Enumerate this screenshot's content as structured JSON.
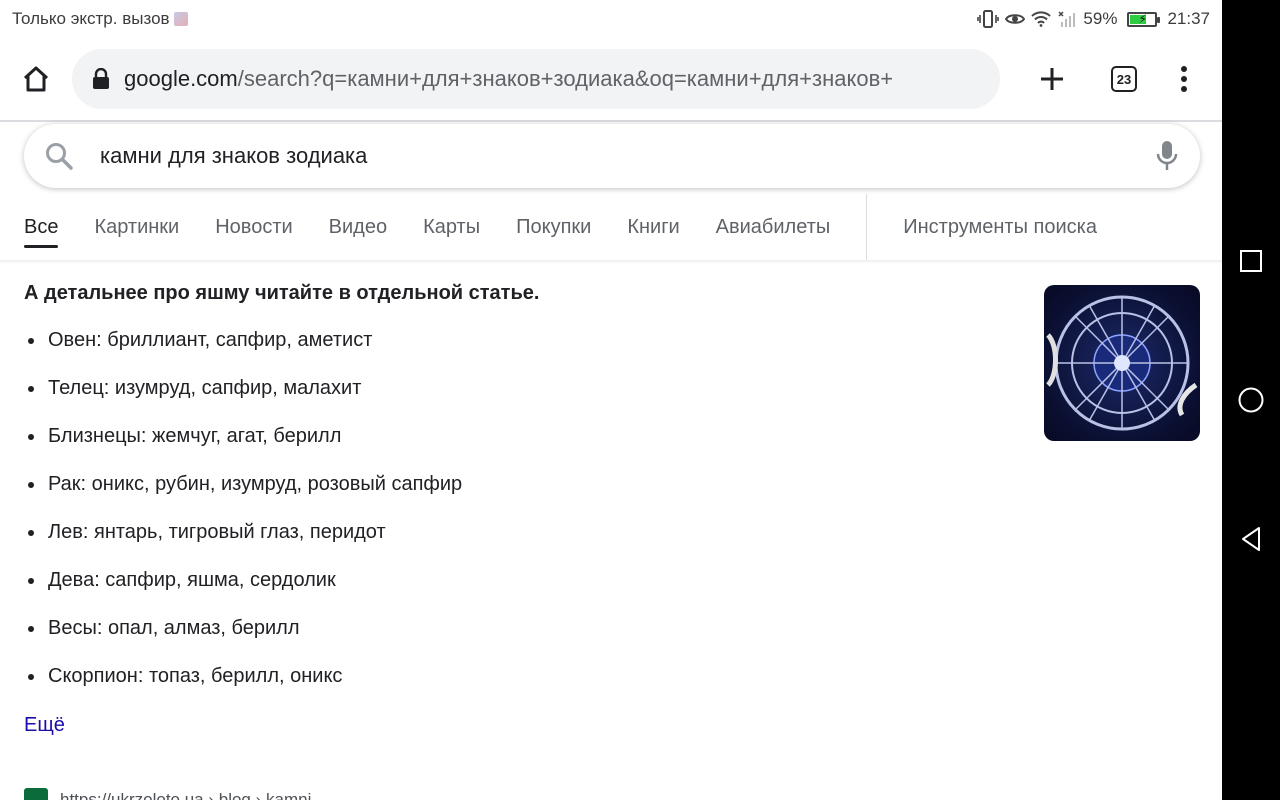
{
  "status_bar": {
    "carrier_text": "Только экстр. вызов",
    "battery_percent": "59%",
    "battery_level": 0.59,
    "time": "21:37"
  },
  "browser": {
    "url_domain": "google.com",
    "url_path": "/search?q=камни+для+знаков+зодиака&oq=камни+для+знаков+",
    "tabs_count": "23"
  },
  "search": {
    "query": "камни для знаков зодиака"
  },
  "tabs": [
    {
      "label": "Все",
      "active": true
    },
    {
      "label": "Картинки",
      "active": false
    },
    {
      "label": "Новости",
      "active": false
    },
    {
      "label": "Видео",
      "active": false
    },
    {
      "label": "Карты",
      "active": false
    },
    {
      "label": "Покупки",
      "active": false
    },
    {
      "label": "Книги",
      "active": false
    },
    {
      "label": "Авиабилеты",
      "active": false
    }
  ],
  "tools_label": "Инструменты поиска",
  "content": {
    "heading": "А детальнее про яшму читайте в отдельной статье.",
    "items": [
      "Овен: бриллиант, сапфир, аметист",
      "Телец: изумруд, сапфир, малахит",
      "Близнецы: жемчуг, агат, берилл",
      "Рак: оникс, рубин, изумруд, розовый сапфир",
      "Лев: янтарь, тигровый глаз, перидот",
      "Дева: сапфир, яшма, сердолик",
      "Весы: опал, алмаз, берилл",
      "Скорпион: топаз, берилл, оникс"
    ],
    "more_link": "Ещё",
    "next_result_url": "https://ukrzoloto.ua › blog › kamni"
  },
  "colors": {
    "link": "#1a0dab",
    "text": "#202124",
    "secondary": "#5f6368",
    "battery": "#2ecc40"
  }
}
